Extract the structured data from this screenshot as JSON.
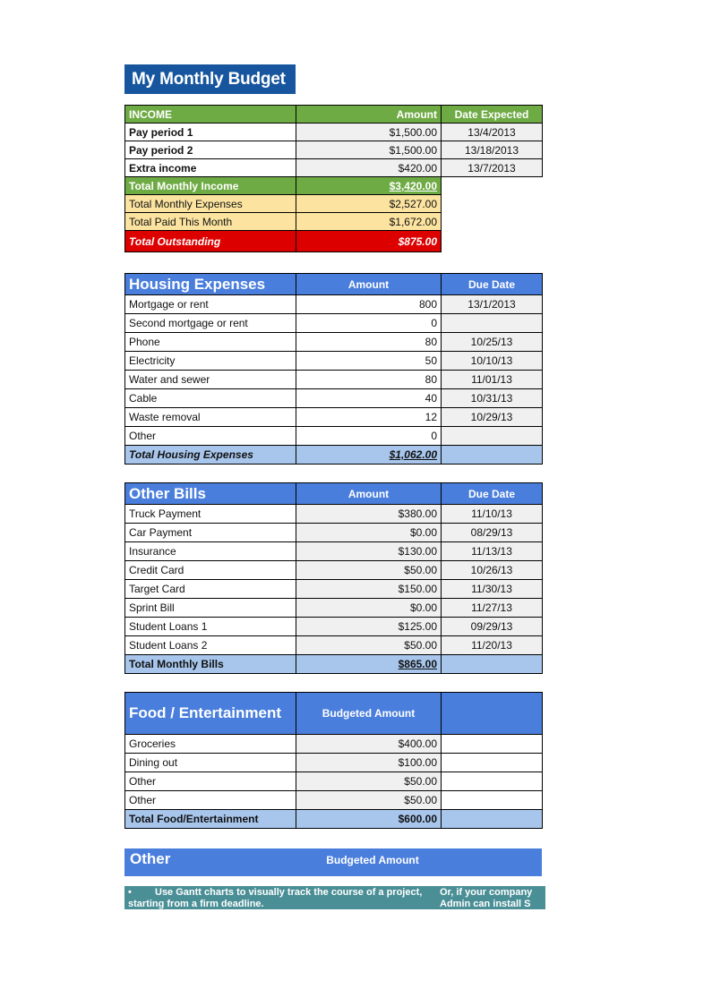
{
  "document": {
    "title": "My Monthly Budget"
  },
  "income": {
    "header": {
      "category": "INCOME",
      "amount": "Amount",
      "date": "Date Expected"
    },
    "rows": [
      {
        "label": "Pay period 1",
        "amount": "$1,500.00",
        "date": "13/4/2013"
      },
      {
        "label": "Pay period 2",
        "amount": "$1,500.00",
        "date": "13/18/2013"
      },
      {
        "label": "Extra income",
        "amount": "$420.00",
        "date": "13/7/2013"
      }
    ],
    "summary": [
      {
        "label": "Total Monthly Income",
        "amount": "$3,420.00"
      },
      {
        "label": "Total Monthly Expenses",
        "amount": "$2,527.00"
      },
      {
        "label": "Total Paid This Month",
        "amount": "$1,672.00"
      },
      {
        "label": "Total Outstanding",
        "amount": "$875.00"
      }
    ]
  },
  "housing": {
    "header": {
      "category": "Housing Expenses",
      "amount": "Amount",
      "date": "Due Date"
    },
    "rows": [
      {
        "label": "Mortgage or rent",
        "amount": "800",
        "date": "13/1/2013"
      },
      {
        "label": "Second mortgage or rent",
        "amount": "0",
        "date": ""
      },
      {
        "label": "Phone",
        "amount": "80",
        "date": "10/25/13"
      },
      {
        "label": "Electricity",
        "amount": "50",
        "date": "10/10/13"
      },
      {
        "label": "Water and sewer",
        "amount": "80",
        "date": "11/01/13"
      },
      {
        "label": "Cable",
        "amount": "40",
        "date": "10/31/13"
      },
      {
        "label": "Waste removal",
        "amount": "12",
        "date": "10/29/13"
      },
      {
        "label": "Other",
        "amount": "0",
        "date": ""
      }
    ],
    "total": {
      "label": "Total Housing Expenses",
      "amount": "$1,062.00"
    }
  },
  "other_bills": {
    "header": {
      "category": "Other Bills",
      "amount": "Amount",
      "date": "Due Date"
    },
    "rows": [
      {
        "label": "Truck Payment",
        "amount": "$380.00",
        "date": "11/10/13"
      },
      {
        "label": "Car Payment",
        "amount": "$0.00",
        "date": "08/29/13"
      },
      {
        "label": "Insurance",
        "amount": "$130.00",
        "date": "11/13/13"
      },
      {
        "label": "Credit Card",
        "amount": "$50.00",
        "date": "10/26/13"
      },
      {
        "label": "Target Card",
        "amount": "$150.00",
        "date": "11/30/13"
      },
      {
        "label": "Sprint Bill",
        "amount": "$0.00",
        "date": "11/27/13"
      },
      {
        "label": "Student Loans 1",
        "amount": "$125.00",
        "date": "09/29/13"
      },
      {
        "label": "Student Loans 2",
        "amount": "$50.00",
        "date": "11/20/13"
      }
    ],
    "total": {
      "label": "Total Monthly Bills",
      "amount": "$865.00"
    }
  },
  "food": {
    "header": {
      "category": "Food / Entertainment",
      "amount": "Budgeted Amount",
      "date": ""
    },
    "rows": [
      {
        "label": "Groceries",
        "amount": "$400.00",
        "date": ""
      },
      {
        "label": "Dining out",
        "amount": "$100.00",
        "date": ""
      },
      {
        "label": "Other",
        "amount": "$50.00",
        "date": ""
      },
      {
        "label": "Other",
        "amount": "$50.00",
        "date": ""
      }
    ],
    "total": {
      "label": "Total Food/Entertainment",
      "amount": "$600.00"
    }
  },
  "other_section": {
    "header": {
      "category": "Other",
      "amount": "Budgeted Amount"
    }
  },
  "footer_banner": {
    "bullet": "•",
    "left_text": "Use Gantt charts to visually track the course of a project, starting from a firm deadline.",
    "right_text": "Or, if your company Admin can install S"
  },
  "colors": {
    "title_blue": "#17569E",
    "header_green": "#6FAB45",
    "header_blue": "#4A7EDC",
    "total_blue": "#A8C6EC",
    "yellow": "#FCE4A0",
    "red": "#DD0000",
    "cell_gray": "#F0F0F0",
    "teal": "#4A8F96"
  }
}
